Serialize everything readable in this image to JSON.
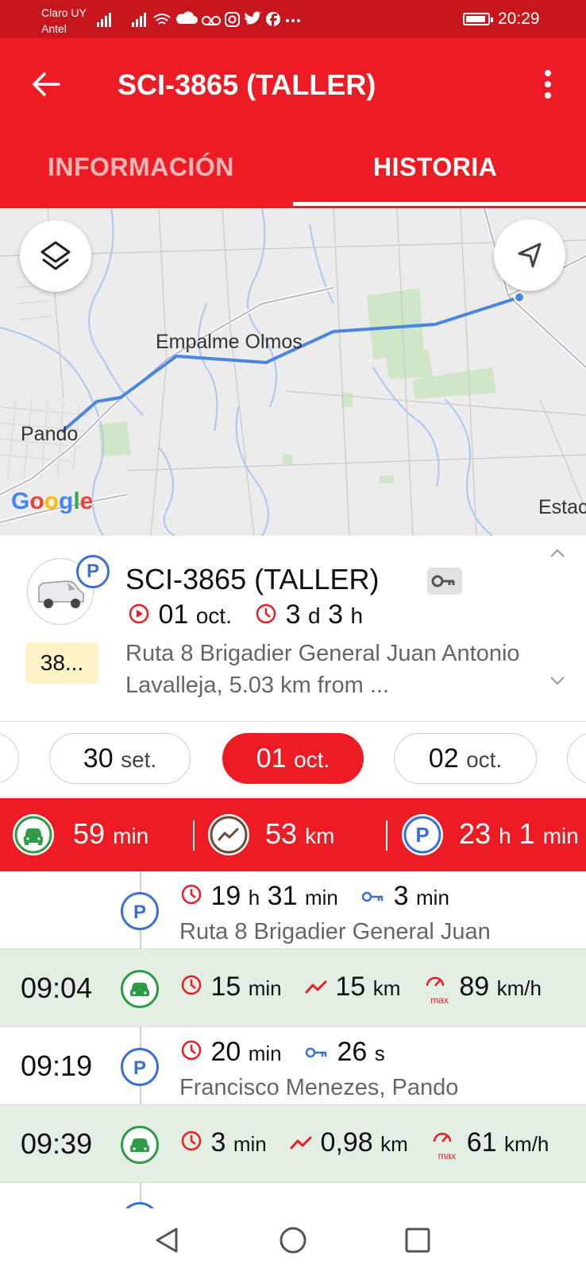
{
  "status_bar": {
    "carrier_1": "Claro UY",
    "carrier_2": "Antel",
    "icons": "signal, signal, wifi, cloud, voicemail, instagram, twitter, facebook, more",
    "time": "20:29"
  },
  "app_bar": {
    "title": "SCI-3865 (TALLER)",
    "back_icon": "arrow-left-icon",
    "menu_icon": "more-vert-icon"
  },
  "tabs": [
    {
      "label": "INFORMACIÓN",
      "selected": false
    },
    {
      "label": "HISTORIA",
      "selected": true
    }
  ],
  "map": {
    "labels": {
      "empalme": "Empalme Olmos",
      "pando": "Pando",
      "esta": "Estac"
    },
    "google": "Google",
    "route_color": "#4a86e0"
  },
  "vehicle": {
    "title": "SCI-3865 (TALLER)",
    "status_badge": "P",
    "odometer": "38...",
    "start_day": "01",
    "start_month": "oct.",
    "duration_days": "3",
    "duration_days_unit": "d",
    "duration_hours": "3",
    "duration_hours_unit": "h",
    "address": "Ruta 8 Brigadier General Juan Antonio Lavalleja, 5.03 km from ..."
  },
  "dates": [
    {
      "day": "30",
      "month": "set.",
      "active": false
    },
    {
      "day": "01",
      "month": "oct.",
      "active": true
    },
    {
      "day": "02",
      "month": "oct.",
      "active": false
    }
  ],
  "summary": {
    "drive_value": "59",
    "drive_unit": "min",
    "distance_value": "53",
    "distance_unit": "km",
    "park_hours": "23",
    "park_hours_unit": "h",
    "park_minutes": "1",
    "park_minutes_unit": "min"
  },
  "timeline": [
    {
      "type": "parking",
      "time": "",
      "dur_h": "19",
      "dur_h_unit": "h",
      "dur_m": "31",
      "dur_m_unit": "min",
      "key_value": "3",
      "key_unit": "min",
      "address": "Ruta 8 Brigadier General Juan"
    },
    {
      "type": "drive",
      "time": "09:04",
      "dur": "15",
      "dur_unit": "min",
      "dist": "15",
      "dist_unit": "km",
      "max_speed": "89",
      "speed_unit": "km/h",
      "max_label": "max"
    },
    {
      "type": "parking",
      "time": "09:19",
      "dur": "20",
      "dur_unit": "min",
      "key_value": "26",
      "key_unit": "s",
      "address": "Francisco Menezes, Pando"
    },
    {
      "type": "drive",
      "time": "09:39",
      "dur": "3",
      "dur_unit": "min",
      "dist": "0,98",
      "dist_unit": "km",
      "max_speed": "61",
      "speed_unit": "km/h",
      "max_label": "max"
    }
  ],
  "colors": {
    "primary": "#ed1c24",
    "status_bar": "#c8161e",
    "parking_blue": "#3a6fd8",
    "drive_green": "#2e9b48",
    "drive_row_bg": "#e2efe2"
  }
}
